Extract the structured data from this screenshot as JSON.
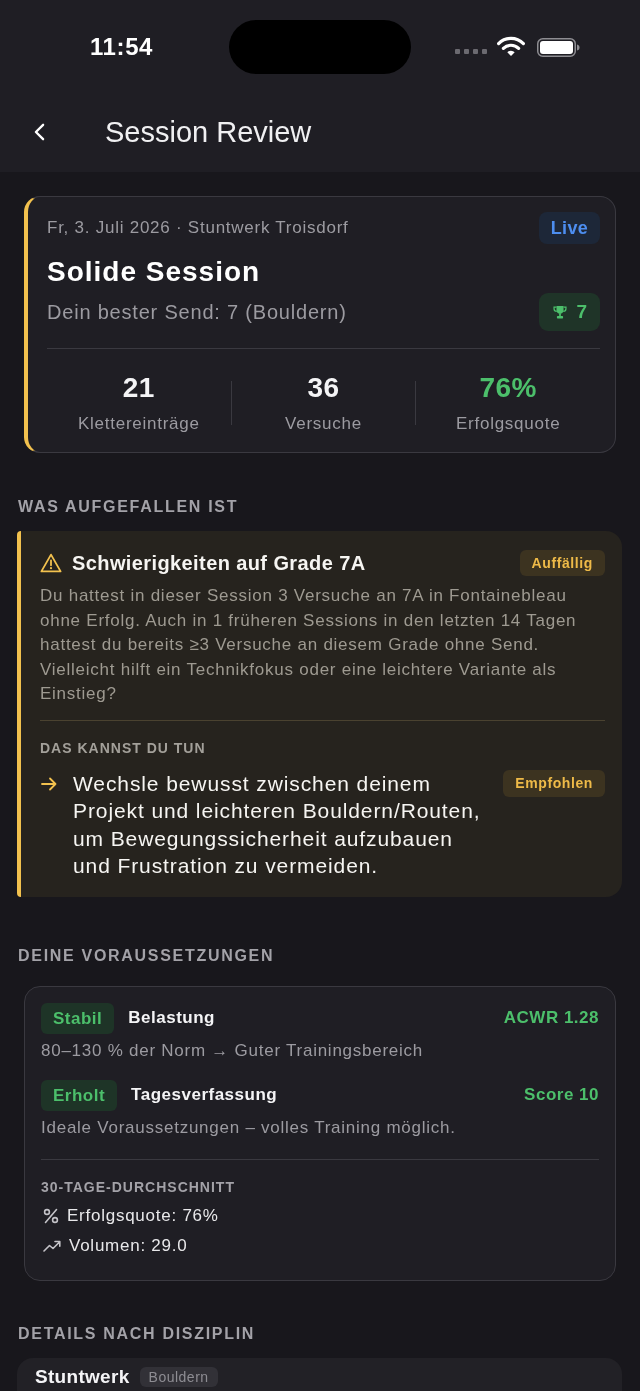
{
  "status_bar": {
    "time": "11:54"
  },
  "nav": {
    "title": "Session Review"
  },
  "summary": {
    "meta": "Fr, 3. Juli 2026 · Stuntwerk Troisdorf",
    "badge": "Live",
    "title": "Solide Session",
    "subtitle": "Dein bester Send: 7 (Bouldern)",
    "best_grade": "7",
    "stats": [
      {
        "value": "21",
        "label": "Klettereinträge",
        "highlight": false
      },
      {
        "value": "36",
        "label": "Versuche",
        "highlight": false
      },
      {
        "value": "76%",
        "label": "Erfolgsquote",
        "highlight": true
      }
    ]
  },
  "insights": {
    "heading": "WAS AUFGEFALLEN IST",
    "items": [
      {
        "kind": "warning",
        "title": "Schwierigkeiten auf Grade 7A",
        "badge": "Auffällig",
        "text": "Du hattest in dieser Session 3 Versuche an 7A in Fontainebleau ohne Erfolg. Auch in 1 früheren Sessions in den letzten 14 Tagen hattest du bereits ≥3 Versuche an diesem Grade ohne Send. Vielleicht hilft ein Technikfokus oder eine leichtere Variante als Einstieg?",
        "actions_heading": "DAS KANNST DU TUN",
        "actions": [
          {
            "text": "Wechsle bewusst zwischen deinem Projekt und leichteren Bouldern/Routen, um Bewegungssicherheit aufzubauen und Frustration zu vermeiden.",
            "badge": "Empfohlen"
          }
        ]
      }
    ]
  },
  "prerequisites": {
    "heading": "DEINE VORAUSSETZUNGEN",
    "items": [
      {
        "status": "Stabil",
        "label": "Belastung",
        "value": "ACWR 1.28",
        "note": "80–130 % der Norm → Guter Trainingsbereich"
      },
      {
        "status": "Erholt",
        "label": "Tagesverfassung",
        "value": "Score 10",
        "note": "Ideale Voraussetzungen – volles Training möglich."
      }
    ],
    "averages": {
      "heading": "30-TAGE-DURCHSCHNITT",
      "items": [
        {
          "kind": "percent",
          "text": "Erfolgsquote: 76%"
        },
        {
          "kind": "trend",
          "text": "Volumen: 29.0"
        }
      ]
    }
  },
  "disciplines": {
    "heading": "DETAILS NACH DISZIPLIN",
    "items": [
      {
        "name": "Stuntwerk",
        "tag": "Bouldern"
      }
    ]
  }
}
